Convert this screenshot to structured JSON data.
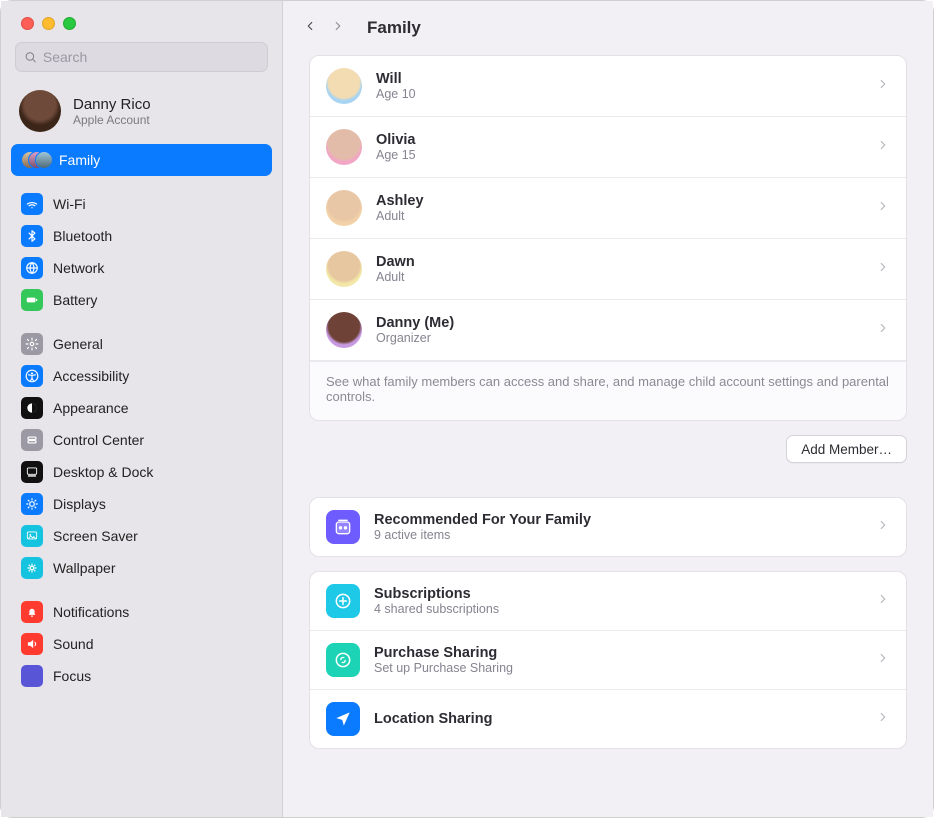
{
  "search": {
    "placeholder": "Search"
  },
  "account": {
    "name": "Danny Rico",
    "sub": "Apple Account"
  },
  "sidebar": {
    "family_label": "Family",
    "groups": [
      [
        {
          "label": "Wi-Fi",
          "icon": "wifi"
        },
        {
          "label": "Bluetooth",
          "icon": "bt"
        },
        {
          "label": "Network",
          "icon": "net"
        },
        {
          "label": "Battery",
          "icon": "bat"
        }
      ],
      [
        {
          "label": "General",
          "icon": "gen"
        },
        {
          "label": "Accessibility",
          "icon": "acc"
        },
        {
          "label": "Appearance",
          "icon": "app"
        },
        {
          "label": "Control Center",
          "icon": "cc"
        },
        {
          "label": "Desktop & Dock",
          "icon": "dock"
        },
        {
          "label": "Displays",
          "icon": "disp"
        },
        {
          "label": "Screen Saver",
          "icon": "ss"
        },
        {
          "label": "Wallpaper",
          "icon": "wall"
        }
      ],
      [
        {
          "label": "Notifications",
          "icon": "notif"
        },
        {
          "label": "Sound",
          "icon": "sound"
        },
        {
          "label": "Focus",
          "icon": "focus"
        }
      ]
    ]
  },
  "main": {
    "title": "Family",
    "members": [
      {
        "name": "Will",
        "sub": "Age 10"
      },
      {
        "name": "Olivia",
        "sub": "Age 15"
      },
      {
        "name": "Ashley",
        "sub": "Adult"
      },
      {
        "name": "Dawn",
        "sub": "Adult"
      },
      {
        "name": "Danny (Me)",
        "sub": "Organizer"
      }
    ],
    "footer_note": "See what family members can access and share, and manage child account settings and parental controls.",
    "add_member_label": "Add Member…",
    "options": [
      {
        "title": "Recommended For Your Family",
        "sub": "9 active items",
        "icon": "rec"
      },
      {
        "title": "Subscriptions",
        "sub": "4 shared subscriptions",
        "icon": "subs"
      },
      {
        "title": "Purchase Sharing",
        "sub": "Set up Purchase Sharing",
        "icon": "purch"
      },
      {
        "title": "Location Sharing",
        "sub": "",
        "icon": "loc"
      }
    ]
  }
}
